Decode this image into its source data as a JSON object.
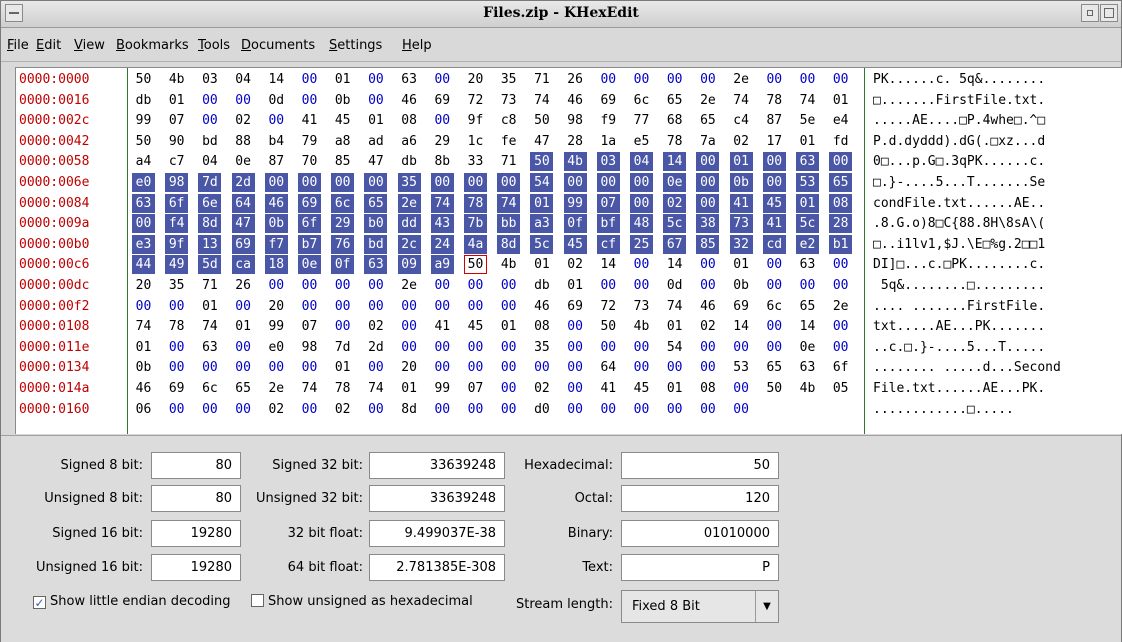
{
  "window": {
    "title": "Files.zip - KHexEdit"
  },
  "menu": [
    "File",
    "Edit",
    "View",
    "Bookmarks",
    "Tools",
    "Documents",
    "Settings",
    "Help"
  ],
  "hex": {
    "rows": [
      {
        "offset": "0000:0000",
        "bytes": [
          "50",
          "4b",
          "03",
          "04",
          "14",
          "00",
          "01",
          "00",
          "63",
          "00",
          "20",
          "35",
          "71",
          "26",
          "00",
          "00",
          "00",
          "00",
          "2e",
          "00",
          "00",
          "00"
        ],
        "ascii": "PK......c. 5q&........"
      },
      {
        "offset": "0000:0016",
        "bytes": [
          "db",
          "01",
          "00",
          "00",
          "0d",
          "00",
          "0b",
          "00",
          "46",
          "69",
          "72",
          "73",
          "74",
          "46",
          "69",
          "6c",
          "65",
          "2e",
          "74",
          "78",
          "74",
          "01"
        ],
        "ascii": "□.......FirstFile.txt."
      },
      {
        "offset": "0000:002c",
        "bytes": [
          "99",
          "07",
          "00",
          "02",
          "00",
          "41",
          "45",
          "01",
          "08",
          "00",
          "9f",
          "c8",
          "50",
          "98",
          "f9",
          "77",
          "68",
          "65",
          "c4",
          "87",
          "5e",
          "e4"
        ],
        "ascii": ".....AE....□P.4whe□.^□"
      },
      {
        "offset": "0000:0042",
        "bytes": [
          "50",
          "90",
          "bd",
          "88",
          "b4",
          "79",
          "a8",
          "ad",
          "a6",
          "29",
          "1c",
          "fe",
          "47",
          "28",
          "1a",
          "e5",
          "78",
          "7a",
          "02",
          "17",
          "01",
          "fd"
        ],
        "ascii": "P.d.dyddd).dG(.□xz...d"
      },
      {
        "offset": "0000:0058",
        "bytes": [
          "a4",
          "c7",
          "04",
          "0e",
          "87",
          "70",
          "85",
          "47",
          "db",
          "8b",
          "33",
          "71",
          "50",
          "4b",
          "03",
          "04",
          "14",
          "00",
          "01",
          "00",
          "63",
          "00"
        ],
        "ascii": "0□...p.G□.3qPK......c."
      },
      {
        "offset": "0000:006e",
        "bytes": [
          "e0",
          "98",
          "7d",
          "2d",
          "00",
          "00",
          "00",
          "00",
          "35",
          "00",
          "00",
          "00",
          "54",
          "00",
          "00",
          "00",
          "0e",
          "00",
          "0b",
          "00",
          "53",
          "65"
        ],
        "ascii": "□.}-....5...T.......Se"
      },
      {
        "offset": "0000:0084",
        "bytes": [
          "63",
          "6f",
          "6e",
          "64",
          "46",
          "69",
          "6c",
          "65",
          "2e",
          "74",
          "78",
          "74",
          "01",
          "99",
          "07",
          "00",
          "02",
          "00",
          "41",
          "45",
          "01",
          "08"
        ],
        "ascii": "condFile.txt......AE.."
      },
      {
        "offset": "0000:009a",
        "bytes": [
          "00",
          "f4",
          "8d",
          "47",
          "0b",
          "6f",
          "29",
          "b0",
          "dd",
          "43",
          "7b",
          "bb",
          "a3",
          "0f",
          "bf",
          "48",
          "5c",
          "38",
          "73",
          "41",
          "5c",
          "28"
        ],
        "ascii": ".8.G.o)8□C{88.8H\\8sA\\("
      },
      {
        "offset": "0000:00b0",
        "bytes": [
          "e3",
          "9f",
          "13",
          "69",
          "f7",
          "b7",
          "76",
          "bd",
          "2c",
          "24",
          "4a",
          "8d",
          "5c",
          "45",
          "cf",
          "25",
          "67",
          "85",
          "32",
          "cd",
          "e2",
          "b1"
        ],
        "ascii": "□..i1lv1,$J.\\E□%g.2□□1"
      },
      {
        "offset": "0000:00c6",
        "bytes": [
          "44",
          "49",
          "5d",
          "ca",
          "18",
          "0e",
          "0f",
          "63",
          "09",
          "a9",
          "50",
          "4b",
          "01",
          "02",
          "14",
          "00",
          "14",
          "00",
          "01",
          "00",
          "63",
          "00"
        ],
        "ascii": "DI]□...c.□PK........c."
      },
      {
        "offset": "0000:00dc",
        "bytes": [
          "20",
          "35",
          "71",
          "26",
          "00",
          "00",
          "00",
          "00",
          "2e",
          "00",
          "00",
          "00",
          "db",
          "01",
          "00",
          "00",
          "0d",
          "00",
          "0b",
          "00",
          "00",
          "00"
        ],
        "ascii": " 5q&........□........."
      },
      {
        "offset": "0000:00f2",
        "bytes": [
          "00",
          "00",
          "01",
          "00",
          "20",
          "00",
          "00",
          "00",
          "00",
          "00",
          "00",
          "00",
          "46",
          "69",
          "72",
          "73",
          "74",
          "46",
          "69",
          "6c",
          "65",
          "2e"
        ],
        "ascii": ".... .......FirstFile."
      },
      {
        "offset": "0000:0108",
        "bytes": [
          "74",
          "78",
          "74",
          "01",
          "99",
          "07",
          "00",
          "02",
          "00",
          "41",
          "45",
          "01",
          "08",
          "00",
          "50",
          "4b",
          "01",
          "02",
          "14",
          "00",
          "14",
          "00"
        ],
        "ascii": "txt.....AE...PK......."
      },
      {
        "offset": "0000:011e",
        "bytes": [
          "01",
          "00",
          "63",
          "00",
          "e0",
          "98",
          "7d",
          "2d",
          "00",
          "00",
          "00",
          "00",
          "35",
          "00",
          "00",
          "00",
          "54",
          "00",
          "00",
          "00",
          "0e",
          "00"
        ],
        "ascii": "..c.□.}-....5...T....."
      },
      {
        "offset": "0000:0134",
        "bytes": [
          "0b",
          "00",
          "00",
          "00",
          "00",
          "00",
          "01",
          "00",
          "20",
          "00",
          "00",
          "00",
          "00",
          "00",
          "64",
          "00",
          "00",
          "00",
          "53",
          "65",
          "63",
          "6f",
          "6e",
          "64"
        ],
        "ascii": "........ .....d...Second"
      },
      {
        "offset": "0000:014a",
        "bytes": [
          "46",
          "69",
          "6c",
          "65",
          "2e",
          "74",
          "78",
          "74",
          "01",
          "99",
          "07",
          "00",
          "02",
          "00",
          "41",
          "45",
          "01",
          "08",
          "00",
          "50",
          "4b",
          "05"
        ],
        "ascii": "File.txt......AE...PK."
      },
      {
        "offset": "0000:0160",
        "bytes": [
          "06",
          "00",
          "00",
          "00",
          "02",
          "00",
          "02",
          "00",
          "8d",
          "00",
          "00",
          "00",
          "d0",
          "00",
          "00",
          "00",
          "00",
          "00",
          "00"
        ],
        "ascii": "............□....."
      }
    ]
  },
  "decoders": {
    "signed8_label": "Signed 8 bit:",
    "signed8": "80",
    "unsigned8_label": "Unsigned 8 bit:",
    "unsigned8": "80",
    "signed16_label": "Signed 16 bit:",
    "signed16": "19280",
    "unsigned16_label": "Unsigned 16 bit:",
    "unsigned16": "19280",
    "signed32_label": "Signed 32 bit:",
    "signed32": "33639248",
    "unsigned32_label": "Unsigned 32 bit:",
    "unsigned32": "33639248",
    "float32_label": "32 bit float:",
    "float32": "9.499037E-38",
    "float64_label": "64 bit float:",
    "float64": "2.781385E-308",
    "hex_label": "Hexadecimal:",
    "hex": "50",
    "octal_label": "Octal:",
    "octal": "120",
    "binary_label": "Binary:",
    "binary": "01010000",
    "text_label": "Text:",
    "text": "P"
  },
  "options": {
    "little_endian_label": "Show little endian decoding",
    "little_endian_checked": true,
    "unsigned_hex_label": "Show unsigned as hexadecimal",
    "stream_length_label": "Stream length:",
    "stream_length_value": "Fixed 8 Bit"
  }
}
